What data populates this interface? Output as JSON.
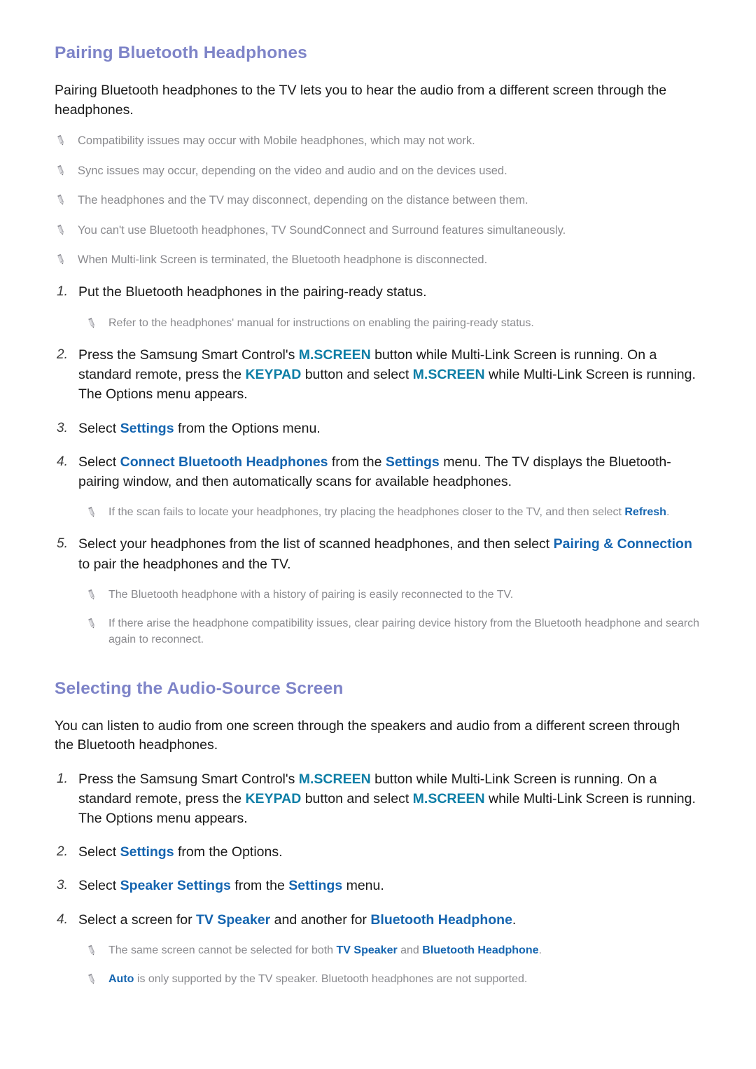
{
  "document": {
    "sections": [
      {
        "heading": "Pairing Bluetooth Headphones",
        "lead": "Pairing Bluetooth headphones to the TV lets you to hear the audio from a different screen through the headphones.",
        "notes_top": [
          "Compatibility issues may occur with Mobile headphones, which may not work.",
          "Sync issues may occur, depending on the video and audio and on the devices used.",
          "The headphones and the TV may disconnect, depending on the distance between them.",
          "You can't use Bluetooth headphones, TV SoundConnect and Surround features simultaneously.",
          "When Multi-link Screen is terminated, the Bluetooth headphone is disconnected."
        ],
        "steps": [
          {
            "num": "1.",
            "parts": [
              {
                "t": "Put the Bluetooth headphones in the pairing-ready status."
              }
            ],
            "notes": [
              {
                "parts": [
                  {
                    "t": "Refer to the headphones' manual for instructions on enabling the pairing-ready status."
                  }
                ]
              }
            ]
          },
          {
            "num": "2.",
            "parts": [
              {
                "t": "Press the Samsung Smart Control's "
              },
              {
                "t": "M.SCREEN",
                "k": "teal"
              },
              {
                "t": " button while Multi-Link Screen is running. On a standard remote, press the "
              },
              {
                "t": "KEYPAD",
                "k": "teal"
              },
              {
                "t": " button and select "
              },
              {
                "t": "M.SCREEN",
                "k": "teal"
              },
              {
                "t": " while Multi-Link Screen is running. The Options menu appears."
              }
            ],
            "notes": []
          },
          {
            "num": "3.",
            "parts": [
              {
                "t": "Select "
              },
              {
                "t": "Settings",
                "k": "blue"
              },
              {
                "t": " from the Options menu."
              }
            ],
            "notes": []
          },
          {
            "num": "4.",
            "parts": [
              {
                "t": "Select "
              },
              {
                "t": "Connect Bluetooth Headphones",
                "k": "blue"
              },
              {
                "t": " from the "
              },
              {
                "t": "Settings",
                "k": "blue"
              },
              {
                "t": " menu. The TV displays the Bluetooth-pairing window, and then automatically scans for available headphones."
              }
            ],
            "notes": [
              {
                "parts": [
                  {
                    "t": "If the scan fails to locate your headphones, try placing the headphones closer to the TV, and then select "
                  },
                  {
                    "t": "Refresh",
                    "k": "blue"
                  },
                  {
                    "t": "."
                  }
                ]
              }
            ]
          },
          {
            "num": "5.",
            "parts": [
              {
                "t": "Select your headphones from the list of scanned headphones, and then select "
              },
              {
                "t": "Pairing & Connection",
                "k": "blue"
              },
              {
                "t": " to pair the headphones and the TV."
              }
            ],
            "notes": [
              {
                "parts": [
                  {
                    "t": "The Bluetooth headphone with a history of pairing is easily reconnected to the TV."
                  }
                ]
              },
              {
                "parts": [
                  {
                    "t": "If there arise the headphone compatibility issues, clear pairing device history from the Bluetooth headphone and search again to reconnect."
                  }
                ]
              }
            ]
          }
        ]
      },
      {
        "heading": "Selecting the Audio-Source Screen",
        "lead": "You can listen to audio from one screen through the speakers and audio from a different screen through the Bluetooth headphones.",
        "notes_top": [],
        "steps": [
          {
            "num": "1.",
            "parts": [
              {
                "t": "Press the Samsung Smart Control's "
              },
              {
                "t": "M.SCREEN",
                "k": "teal"
              },
              {
                "t": " button while Multi-Link Screen is running. On a standard remote, press the "
              },
              {
                "t": "KEYPAD",
                "k": "teal"
              },
              {
                "t": " button and select "
              },
              {
                "t": "M.SCREEN",
                "k": "teal"
              },
              {
                "t": " while Multi-Link Screen is running. The Options menu appears."
              }
            ],
            "notes": []
          },
          {
            "num": "2.",
            "parts": [
              {
                "t": "Select "
              },
              {
                "t": "Settings",
                "k": "blue"
              },
              {
                "t": " from the Options."
              }
            ],
            "notes": []
          },
          {
            "num": "3.",
            "parts": [
              {
                "t": "Select "
              },
              {
                "t": "Speaker Settings",
                "k": "blue"
              },
              {
                "t": " from the "
              },
              {
                "t": "Settings",
                "k": "blue"
              },
              {
                "t": " menu."
              }
            ],
            "notes": []
          },
          {
            "num": "4.",
            "parts": [
              {
                "t": "Select a screen for "
              },
              {
                "t": "TV Speaker",
                "k": "blue"
              },
              {
                "t": " and another for "
              },
              {
                "t": "Bluetooth Headphone",
                "k": "blue"
              },
              {
                "t": "."
              }
            ],
            "notes": [
              {
                "parts": [
                  {
                    "t": "The same screen cannot be selected for both "
                  },
                  {
                    "t": "TV Speaker",
                    "k": "blue"
                  },
                  {
                    "t": " and "
                  },
                  {
                    "t": "Bluetooth Headphone",
                    "k": "blue"
                  },
                  {
                    "t": "."
                  }
                ]
              },
              {
                "parts": [
                  {
                    "t": "Auto",
                    "k": "blue"
                  },
                  {
                    "t": " is only supported by the TV speaker. Bluetooth headphones are not supported."
                  }
                ]
              }
            ]
          }
        ]
      }
    ],
    "icons": {
      "note_bullet": "pencil-icon"
    },
    "colors": {
      "heading": "#7e84c8",
      "accent_teal": "#0d7ea6",
      "accent_blue": "#1565b0",
      "body": "#1a1a1a",
      "note": "#8a8a8e"
    }
  }
}
